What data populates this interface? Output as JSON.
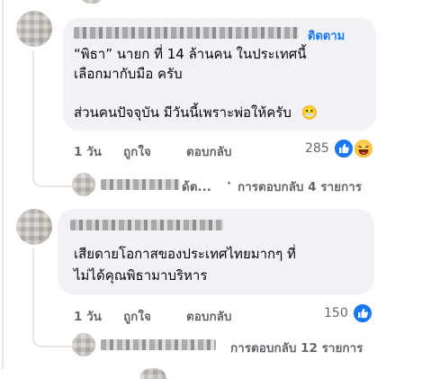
{
  "comments": [
    {
      "follow_label": "ติดตาม",
      "lines": [
        "“พิธา” นายก ที่ 14 ล้านคน ในประเทศนี้",
        "เลือกมากับมือ ครับ",
        "ส่วนคนปัจจุบัน มีวันนี้เพราะพ่อให้ครับ"
      ],
      "emoji": "😬",
      "time": "1 วัน",
      "like": "ถูกใจ",
      "reply": "ตอบกลับ",
      "reaction_count": "285",
      "replies_summary": {
        "name_suffix": "ด้ต...",
        "sep": "·",
        "label": "การตอบกลับ 4 รายการ"
      }
    },
    {
      "lines": [
        "เสียดายโอกาสของประเทศไทยมากๆ ที่",
        "ไม่ได้คุณพิธามาบริหาร"
      ],
      "time": "1 วัน",
      "like": "ถูกใจ",
      "reply": "ตอบกลับ",
      "reaction_count": "150",
      "replies_summary": {
        "label": "การตอบกลับ 12 รายการ"
      }
    }
  ],
  "colors": {
    "bubble": "#f0f2f5",
    "accent": "#1877f2",
    "meta": "#65676b"
  }
}
